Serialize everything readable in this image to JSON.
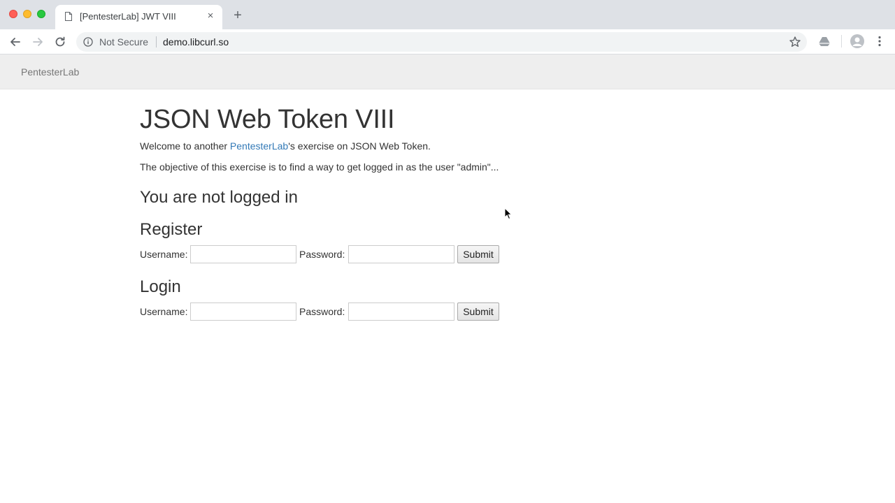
{
  "browser": {
    "tab_title": "[PentesterLab] JWT VIII",
    "tab_close_glyph": "×",
    "new_tab_glyph": "+",
    "security_label": "Not Secure",
    "url": "demo.libcurl.so"
  },
  "site": {
    "brand": "PentesterLab"
  },
  "page": {
    "title": "JSON Web Token VIII",
    "welcome_prefix": "Welcome to another ",
    "welcome_link": "PentesterLab",
    "welcome_suffix": "'s exercise on JSON Web Token.",
    "objective": "The objective of this exercise is to find a way to get logged in as the user \"admin\"...",
    "status": "You are not logged in"
  },
  "register": {
    "heading": "Register",
    "username_label": "Username:",
    "username_value": "",
    "password_label": "Password:",
    "password_value": "",
    "submit_label": "Submit"
  },
  "login": {
    "heading": "Login",
    "username_label": "Username:",
    "username_value": "",
    "password_label": "Password:",
    "password_value": "",
    "submit_label": "Submit"
  },
  "colors": {
    "link": "#337ab7",
    "navbar_bg": "#eeeeee",
    "tabstrip_bg": "#dee1e6"
  }
}
